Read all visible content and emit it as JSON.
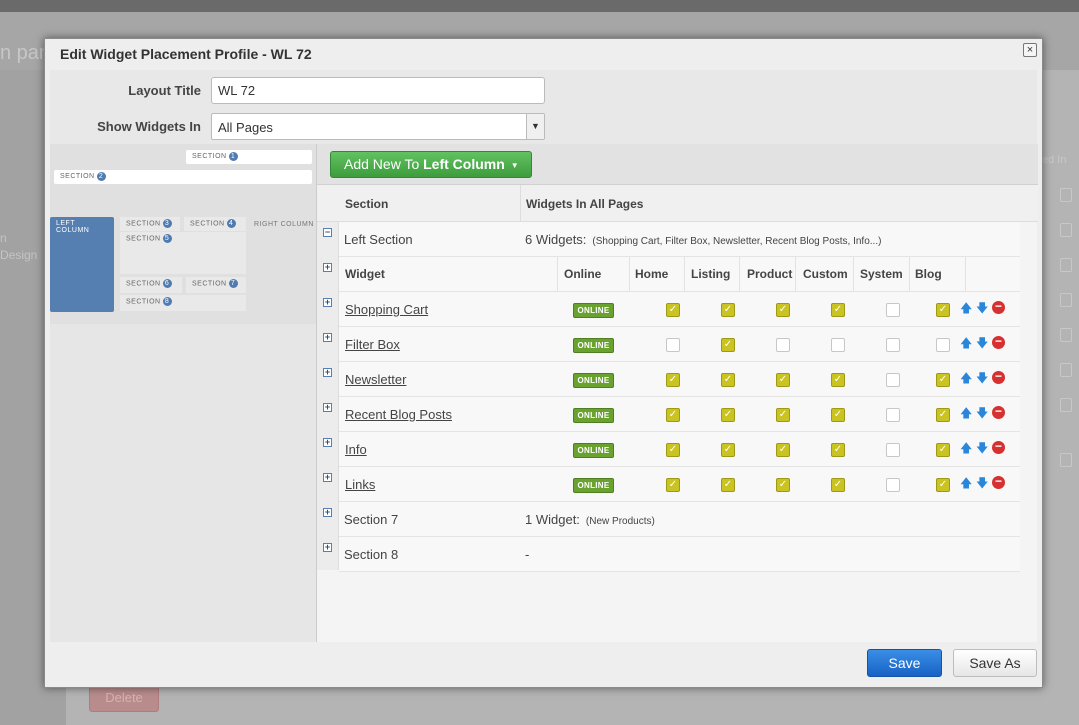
{
  "background": {
    "page_title": "n pane",
    "left_text": [
      "n",
      "Design"
    ],
    "right_header": "ed In",
    "delete_label": "Delete"
  },
  "dialog": {
    "title": "Edit Widget Placement Profile - WL 72",
    "close_icon": "close-icon"
  },
  "form": {
    "layout_title_label": "Layout Title",
    "layout_title_value": "WL 72",
    "show_widgets_label": "Show Widgets In",
    "show_widgets_value": "All Pages"
  },
  "diagram": {
    "section_label": "SECTION",
    "left_column": "LEFT COLUMN",
    "right_column": "RIGHT COLUMN",
    "numbers": [
      "1",
      "2",
      "3",
      "4",
      "5",
      "6",
      "7",
      "8"
    ]
  },
  "toolbar": {
    "add_prefix": "Add New To ",
    "add_target": "Left Column"
  },
  "table": {
    "col_section": "Section",
    "col_widgets": "Widgets In All Pages",
    "left_section": {
      "name": "Left Section",
      "count": "6 Widgets:",
      "summary": "(Shopping Cart, Filter Box, Newsletter, Recent Blog Posts, Info...)"
    },
    "widget_headers": [
      "Widget",
      "Online",
      "Home",
      "Listing",
      "Product",
      "Custom",
      "System",
      "Blog"
    ],
    "online_label": "ONLINE",
    "widgets": [
      {
        "name": "Shopping Cart",
        "checks": [
          true,
          true,
          true,
          true,
          false,
          true
        ]
      },
      {
        "name": "Filter Box",
        "checks": [
          false,
          true,
          false,
          false,
          false,
          false
        ]
      },
      {
        "name": "Newsletter",
        "checks": [
          true,
          true,
          true,
          true,
          false,
          true
        ]
      },
      {
        "name": "Recent Blog Posts",
        "checks": [
          true,
          true,
          true,
          true,
          false,
          true
        ]
      },
      {
        "name": "Info",
        "checks": [
          true,
          true,
          true,
          true,
          false,
          true
        ]
      },
      {
        "name": "Links",
        "checks": [
          true,
          true,
          true,
          true,
          false,
          true
        ]
      }
    ],
    "section7": {
      "name": "Section 7",
      "count": "1 Widget:",
      "summary": "(New Products)"
    },
    "section8": {
      "name": "Section 8",
      "count": "-"
    }
  },
  "footer": {
    "save_label": "Save",
    "save_as_label": "Save As"
  }
}
